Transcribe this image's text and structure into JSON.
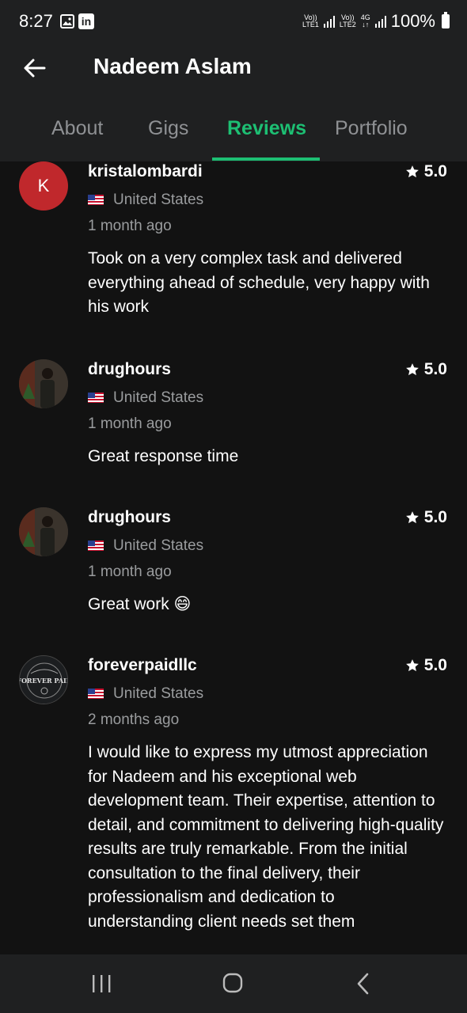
{
  "status_bar": {
    "time": "8:27",
    "sim1_label": "VoLTE1",
    "sim2_label": "VoLTE2",
    "network": "4G",
    "battery": "100%"
  },
  "header": {
    "title": "Nadeem Aslam",
    "back_icon": "arrow-left-icon"
  },
  "tabs": [
    {
      "label": "About",
      "active": false
    },
    {
      "label": "Gigs",
      "active": false
    },
    {
      "label": "Reviews",
      "active": true
    },
    {
      "label": "Portfolio",
      "active": false
    }
  ],
  "accent_color": "#1dbf73",
  "reviews": [
    {
      "avatar_letter": "K",
      "username": "kristalombardi",
      "rating": "5.0",
      "country": "United States",
      "time": "1 month ago",
      "text": "Took on a very complex task and delivered everything ahead of schedule, very happy with his work"
    },
    {
      "username": "drughours",
      "rating": "5.0",
      "country": "United States",
      "time": "1 month ago",
      "text": "Great response time"
    },
    {
      "username": "drughours",
      "rating": "5.0",
      "country": "United States",
      "time": "1 month ago",
      "text": "Great work 😄"
    },
    {
      "username": "foreverpaidllc",
      "rating": "5.0",
      "country": "United States",
      "time": "2 months ago",
      "logo_text": "FOREVER PAID",
      "text": "I would like to express my utmost appreciation for Nadeem and his exceptional web development team. Their expertise, attention to detail, and commitment to delivering high-quality results are truly remarkable. From the initial consultation to the final delivery, their professionalism and dedication to understanding client needs set them"
    }
  ]
}
